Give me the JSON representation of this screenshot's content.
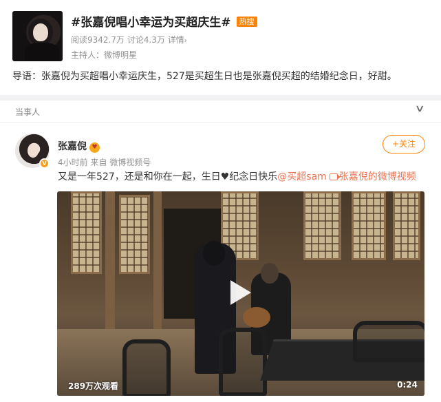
{
  "topic": {
    "title": "#张嘉倪唱小幸运为买超庆生#",
    "badge": "热搜",
    "reads": "阅读9342.7万",
    "discussions": "讨论4.3万",
    "details": "详情",
    "host": "主持人：微博明星",
    "guide": "导语：张嘉倪为买超唱小幸运庆生，527是买超生日也是张嘉倪买超的结婚纪念日，好甜。"
  },
  "section": {
    "title": "当事人"
  },
  "post": {
    "user_name": "张嘉倪",
    "follow_label": "+关注",
    "time": "4小时前",
    "source": "来自 微博视频号",
    "text_before": "又是一年527，还是和你在一起，生日",
    "heart": "♥",
    "text_after": "纪念日快乐",
    "mention": "@买超sam",
    "video_link": "张嘉倪的微博视频",
    "video": {
      "views": "289万次观看",
      "duration": "0:24"
    }
  },
  "colors": {
    "accent": "#ff8200",
    "link": "#eb7350",
    "meta": "#939393"
  },
  "icons": {
    "chevron": "chevron-down-icon",
    "play": "play-icon",
    "verified": "verified-badge-icon"
  }
}
